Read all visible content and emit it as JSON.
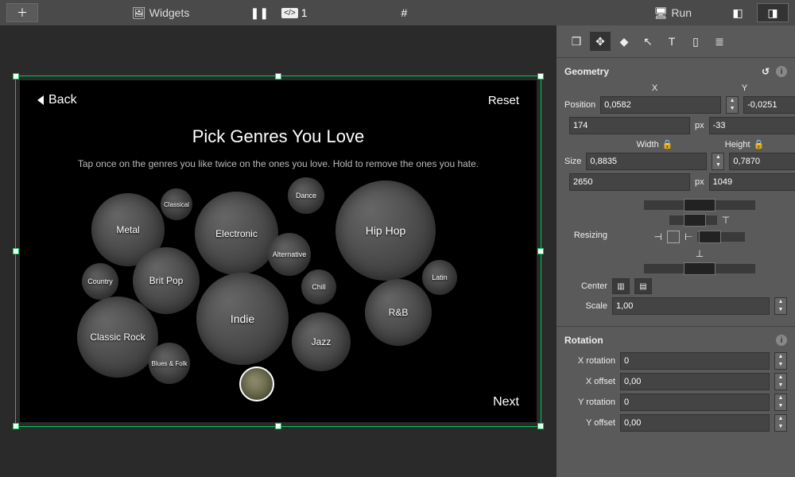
{
  "topbar": {
    "widgets_label": "Widgets",
    "code_count": "1",
    "run_label": "Run"
  },
  "canvas": {
    "back_label": "Back",
    "reset_label": "Reset",
    "title": "Pick Genres You Love",
    "subtitle": "Tap once on the genres you like twice on the ones you love. Hold to remove the ones you hate.",
    "next_label": "Next",
    "genres": [
      "Classical",
      "Metal",
      "Electronic",
      "Dance",
      "Hip Hop",
      "Brit Pop",
      "Alternative",
      "Country",
      "Indie",
      "Chill",
      "Latin",
      "Classic Rock",
      "R&B",
      "Jazz",
      "Blues & Folk"
    ]
  },
  "tools": {
    "cube_icon": "cube",
    "move_icon": "move",
    "paint_icon": "paint",
    "cursor_icon": "cursor",
    "text_icon": "text",
    "device_icon": "device",
    "db_icon": "database"
  },
  "geometry": {
    "section_label": "Geometry",
    "x_label": "X",
    "y_label": "Y",
    "position_label": "Position",
    "position_x": "0,0582",
    "position_y": "-0,0251",
    "position_x_px": "174",
    "position_y_px": "-33",
    "px_unit": "px",
    "width_label": "Width",
    "height_label": "Height",
    "size_label": "Size",
    "size_w": "0,8835",
    "size_h": "0,7870",
    "size_w_px": "2650",
    "size_h_px": "1049",
    "resizing_label": "Resizing",
    "center_label": "Center",
    "scale_label": "Scale",
    "scale_value": "1,00"
  },
  "rotation": {
    "section_label": "Rotation",
    "x_rotation_label": "X rotation",
    "x_rotation": "0",
    "x_offset_label": "X offset",
    "x_offset": "0,00",
    "y_rotation_label": "Y rotation",
    "y_rotation": "0",
    "y_offset_label": "Y offset",
    "y_offset": "0,00"
  }
}
